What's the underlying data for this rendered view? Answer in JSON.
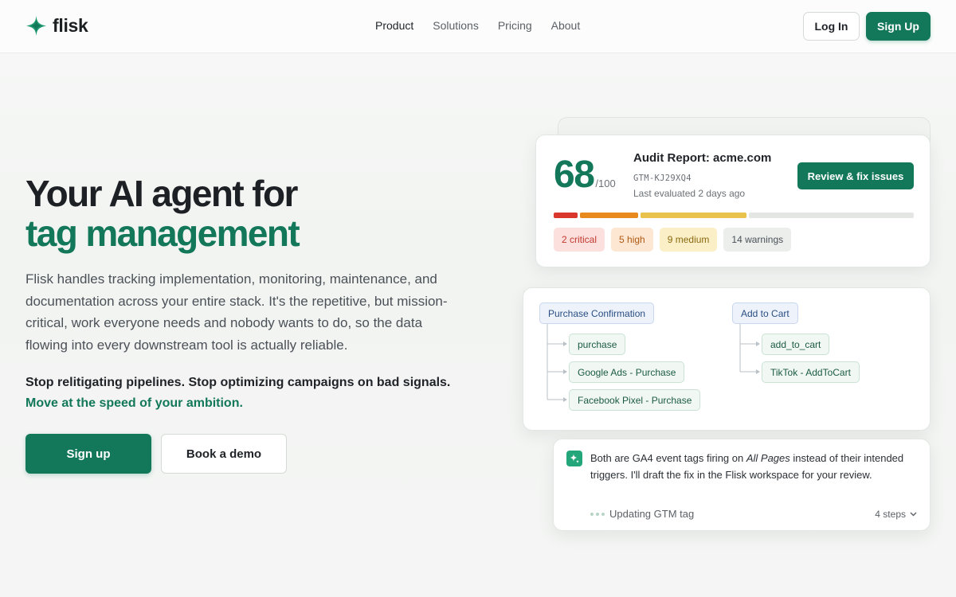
{
  "brand": {
    "name": "flisk",
    "accent": "#13775a"
  },
  "nav": {
    "items": [
      {
        "label": "Product",
        "active": true
      },
      {
        "label": "Solutions",
        "active": false
      },
      {
        "label": "Pricing",
        "active": false
      },
      {
        "label": "About",
        "active": false
      }
    ],
    "login_label": "Log In",
    "signup_label": "Sign Up"
  },
  "hero": {
    "title_line1": "Your AI agent for",
    "title_line2": "tag management",
    "description": "Flisk handles tracking implementation, monitoring, maintenance, and documentation across your entire stack. It's the repetitive, but mission-critical, work everyone needs and nobody wants to do, so the data flowing into every downstream tool is actually reliable.",
    "strong_line1": "Stop relitigating pipelines. Stop optimizing campaigns on bad signals.",
    "strong_line2": "Move at the speed of your ambition.",
    "signup_label": "Sign up",
    "demo_label": "Book a demo"
  },
  "audit": {
    "score": "68",
    "score_max": "/100",
    "title": "Audit Report: acme.com",
    "container_id": "GTM-KJ29XQ4",
    "evaluated": "Last evaluated 2 days ago",
    "review_label": "Review & fix issues",
    "segments": [
      {
        "label": "critical",
        "count": 2,
        "color": "#d9372c"
      },
      {
        "label": "high",
        "count": 5,
        "color": "#e8891d"
      },
      {
        "label": "medium",
        "count": 9,
        "color": "#e8c24a"
      },
      {
        "label": "warnings",
        "count": 14,
        "color": "#e3e6e3"
      }
    ],
    "badges": {
      "critical": "2 critical",
      "high": "5 high",
      "medium": "9 medium",
      "warnings": "14 warnings"
    }
  },
  "tree": {
    "groups": [
      {
        "trigger": "Purchase Confirmation",
        "tags": [
          "purchase",
          "Google Ads - Purchase",
          "Facebook Pixel - Purchase"
        ]
      },
      {
        "trigger": "Add to Cart",
        "tags": [
          "add_to_cart",
          "TikTok - AddToCart"
        ]
      }
    ]
  },
  "agent": {
    "msg_before": "Both are GA4 event tags firing on ",
    "msg_em": "All Pages",
    "msg_after": " instead of their intended triggers. I'll draft the fix in the Flisk workspace for your review.",
    "status": "Updating GTM tag",
    "steps": "4 steps"
  }
}
